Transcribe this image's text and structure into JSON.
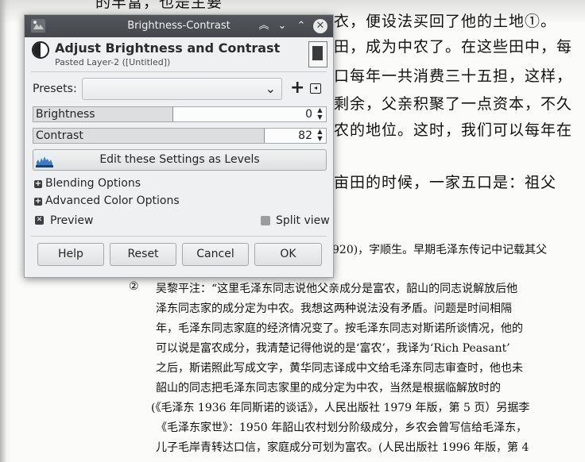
{
  "document": {
    "top_fragment": "的丰富，也是主要",
    "lines_right": [
      "衣，便设法买回了他的土地①。",
      "田，成为中农了。在这些田中，每",
      "口每年一共消费三十五担，这样，",
      "剩余，父亲积聚了一点资本，不久",
      "农的地位。这时，我们可以每年在",
      "亩田的时候，一家五口是：祖父"
    ],
    "footnote1_fragment": "920)，字顺生。早期毛泽东传记中记载其父",
    "footnote2_marker": "②",
    "footnote2_lines": [
      "吴黎平注：“这里毛泽东同志说他父亲成分是富农，韶山的同志说解放后他",
      "泽东同志家的成分定为中农。我想这两种说法没有矛盾。问题是时间相隔",
      "年，毛泽东同志家庭的经济情况变了。按毛泽东同志对斯诺所谈情况，他的",
      "可以说是富农成分，我清楚记得他说的是‘富农’，我译为‘Rich Peasant’",
      "之后，斯诺照此写成文字，黄华同志译成中文给毛泽东同志审查时，他也未",
      "韶山的同志把毛泽东同志家里的成分定为中农，当然是根据临解放时的",
      "(《毛泽东 1936 年同斯诺的谈话》，人民出版社 1979 年版，第 5 页）另据李",
      "《毛泽东家世》：1950 年韶山农村划分阶级成分，乡农会曾写信给毛泽东，",
      "儿子毛岸青转达口信，家庭成分可划为富农。(人民出版社 1996 年版，第 4"
    ]
  },
  "dialog": {
    "window_title": "Brightness-Contrast",
    "header_title": "Adjust Brightness and Contrast",
    "header_subtitle": "Pasted Layer-2 ([Untitled])",
    "presets_label": "Presets:",
    "presets_value": "",
    "brightness": {
      "label": "Brightness",
      "value": "0",
      "fraction": 0.5
    },
    "contrast": {
      "label": "Contrast",
      "value": "82",
      "fraction": 0.82
    },
    "levels_button": "Edit these Settings as Levels",
    "blending_options": "Blending Options",
    "advanced_color_options": "Advanced Color Options",
    "preview_label": "Preview",
    "preview_checked": true,
    "split_view_label": "Split view",
    "split_view_checked": false,
    "buttons": {
      "help": "Help",
      "reset": "Reset",
      "cancel": "Cancel",
      "ok": "OK"
    },
    "titlebar_colors": {
      "bar": "#4a4e53",
      "dialog_bg": "#eff0f1"
    }
  }
}
